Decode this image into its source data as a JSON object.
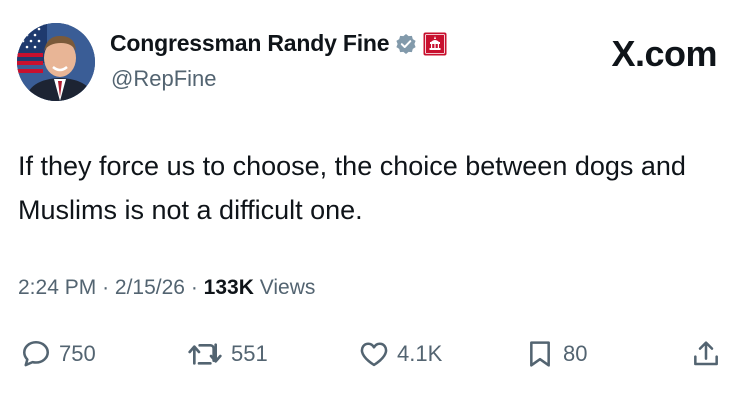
{
  "author": {
    "display_name": "Congressman Randy Fine",
    "handle": "@RepFine",
    "avatar_icon": "profile-photo",
    "verified_icon": "gray-verified-badge",
    "affiliation_icon": "us-house-seal-badge"
  },
  "brand": "X.com",
  "tweet": {
    "text": "If they force us to choose, the choice between dogs and Muslims is not a difficult one."
  },
  "meta": {
    "time": "2:24 PM",
    "separator": "·",
    "date": "2/15/26",
    "views_count": "133K",
    "views_label": "Views"
  },
  "actions": {
    "replies": "750",
    "reposts": "551",
    "likes": "4.1K",
    "bookmarks": "80"
  },
  "colors": {
    "text": "#0f1419",
    "secondary": "#536471",
    "verified_badge": "#829aab",
    "affiliation_badge": "#c8102e"
  }
}
